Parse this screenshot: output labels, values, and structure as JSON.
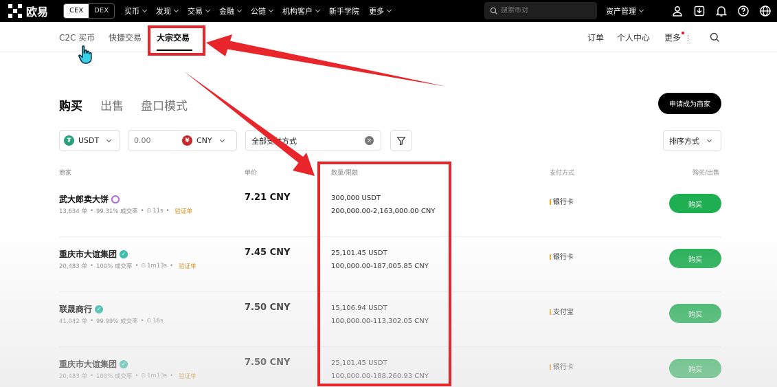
{
  "topbar": {
    "brand": "欧易",
    "segments": [
      "CEX",
      "DEX"
    ],
    "nav": [
      "买币",
      "发现",
      "交易",
      "金融",
      "公链",
      "机构客户",
      "新手学院",
      "更多"
    ],
    "search_placeholder": "搜索币对",
    "asset_menu": "资产管理"
  },
  "subnav": {
    "left": [
      "C2C 买币",
      "快捷交易",
      "大宗交易"
    ],
    "right": [
      "订单",
      "个人中心",
      "更多"
    ]
  },
  "tabs": [
    "购买",
    "出售",
    "盘口模式"
  ],
  "merchant_button": "申请成为商家",
  "filters": {
    "coin": "USDT",
    "amount_placeholder": "0.00",
    "fiat": "CNY",
    "payment": "全部支付方式",
    "sort": "排序方式"
  },
  "table": {
    "headers": [
      "商家",
      "单价",
      "数量/限额",
      "支付方式",
      "购买/出售"
    ],
    "rows": [
      {
        "name": "武大郎卖大饼",
        "orders": "13,634 单",
        "rate": "99.31% 成交率",
        "time": "11s",
        "verify": "验证单",
        "price": "7.21 CNY",
        "qty": "300,000 USDT",
        "limit": "200,000.00-2,163,000.00 CNY",
        "payment": "银行卡",
        "action": "购买"
      },
      {
        "name": "重庆市大谊集团",
        "orders": "20,483 单",
        "rate": "100% 成交率",
        "time": "1m13s",
        "verify": "验证单",
        "price": "7.45 CNY",
        "qty": "25,101.45 USDT",
        "limit": "100,000.00-187,005.85 CNY",
        "payment": "银行卡",
        "action": "购买"
      },
      {
        "name": "联晟商行",
        "orders": "41,042 单",
        "rate": "99.99% 成交率",
        "time": "16s",
        "verify": "",
        "price": "7.50 CNY",
        "qty": "15,106.94 USDT",
        "limit": "100,000.00-113,302.05 CNY",
        "payment": "支付宝",
        "action": "购买"
      },
      {
        "name": "重庆市大谊集团",
        "orders": "20,483 单",
        "rate": "100% 成交率",
        "time": "1m13s",
        "verify": "验证单",
        "price": "7.50 CNY",
        "qty": "25,101.45 USDT",
        "limit": "100,000.00-188,260.93 CNY",
        "payment": "银行卡",
        "action": "购买"
      }
    ]
  },
  "colors": {
    "accent_green": "#1fae52",
    "annotation_red": "#e8252a",
    "verify_orange": "#d08a16"
  }
}
